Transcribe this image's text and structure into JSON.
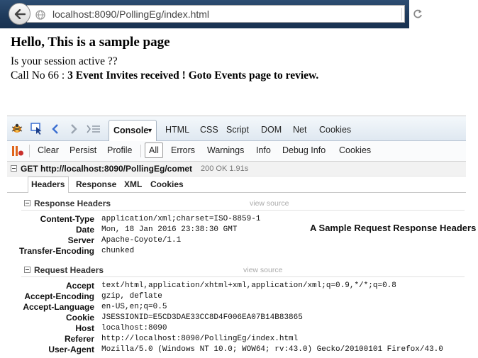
{
  "browser": {
    "url": "localhost:8090/PollingEg/index.html"
  },
  "page": {
    "heading": "Hello, This is a sample page",
    "session_question": "Is your session active ??",
    "call_prefix": "Call No 66 : ",
    "call_message": "3 Event Invites received ! Goto Events page to review."
  },
  "firebug": {
    "tabs": [
      "Console",
      "HTML",
      "CSS",
      "Script",
      "DOM",
      "Net",
      "Cookies"
    ],
    "active_tab": "Console",
    "filter_bar": {
      "clear": "Clear",
      "persist": "Persist",
      "profile": "Profile",
      "all": "All",
      "errors": "Errors",
      "warnings": "Warnings",
      "info": "Info",
      "debug_info": "Debug Info",
      "cookies": "Cookies"
    },
    "request": {
      "summary": "GET http://localhost:8090/PollingEg/comet",
      "status": "200 OK 1.91s"
    },
    "sub_tabs": [
      "Headers",
      "Response",
      "XML",
      "Cookies"
    ],
    "active_sub_tab": "Headers",
    "response_headers": {
      "title": "Response Headers",
      "view_source": "view source",
      "rows": [
        {
          "name": "Content-Type",
          "value": "application/xml;charset=ISO-8859-1"
        },
        {
          "name": "Date",
          "value": "Mon, 18 Jan 2016 23:38:30 GMT"
        },
        {
          "name": "Server",
          "value": "Apache-Coyote/1.1"
        },
        {
          "name": "Transfer-Encoding",
          "value": "chunked"
        }
      ]
    },
    "request_headers": {
      "title": "Request Headers",
      "view_source": "view source",
      "rows": [
        {
          "name": "Accept",
          "value": "text/html,application/xhtml+xml,application/xml;q=0.9,*/*;q=0.8"
        },
        {
          "name": "Accept-Encoding",
          "value": "gzip, deflate"
        },
        {
          "name": "Accept-Language",
          "value": "en-US,en;q=0.5"
        },
        {
          "name": "Cookie",
          "value": "JSESSIONID=E5CD3DAE33CC8D4F006EA07B14B83865"
        },
        {
          "name": "Host",
          "value": "localhost:8090"
        },
        {
          "name": "Referer",
          "value": "http://localhost:8090/PollingEg/index.html"
        },
        {
          "name": "User-Agent",
          "value": "Mozilla/5.0 (Windows NT 10.0; WOW64; rv:43.0) Gecko/20100101 Firefox/43.0"
        }
      ]
    },
    "annotation": "A Sample Request Response Headers"
  },
  "colors": {
    "toolbar_blue": "#3a6ed1",
    "annotation_text": "#111111"
  }
}
